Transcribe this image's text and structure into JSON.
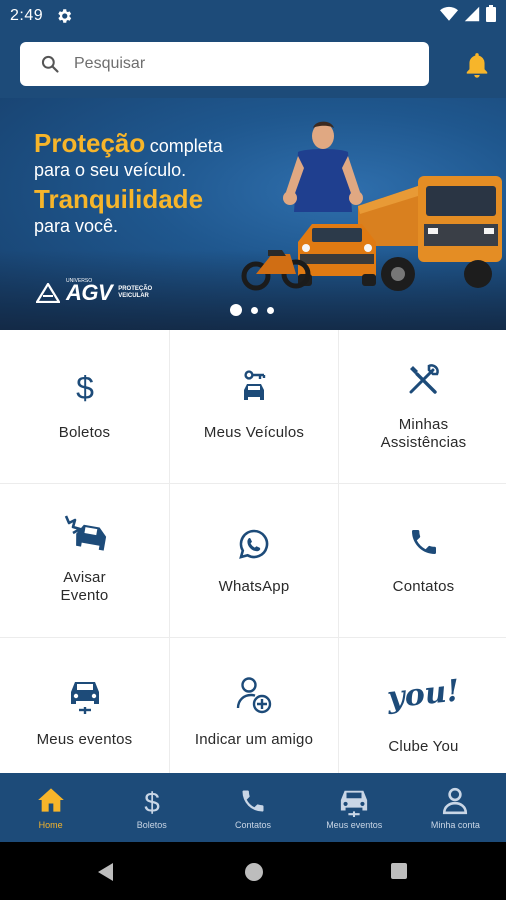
{
  "status_bar": {
    "time": "2:49"
  },
  "header": {
    "search_placeholder": "Pesquisar"
  },
  "banner": {
    "line1_highlight": "Proteção",
    "line1_rest": "completa",
    "line2": "para o seu veículo.",
    "line3_highlight": "Tranquilidade",
    "line4": "para você.",
    "brand": "AGV",
    "brand_top": "UNIVERSO",
    "brand_sub": "PROTEÇÃO VEICULAR",
    "slide_count": 3,
    "active_slide": 1
  },
  "grid": {
    "boletos": "Boletos",
    "meus_veiculos": "Meus Veículos",
    "minhas_assistencias_1": "Minhas",
    "minhas_assistencias_2": "Assistências",
    "avisar_evento_1": "Avisar",
    "avisar_evento_2": "Evento",
    "whatsapp": "WhatsApp",
    "contatos": "Contatos",
    "meus_eventos": "Meus eventos",
    "indicar_amigo": "Indicar um amigo",
    "clube_you": "Clube You",
    "clube_you_logo": "you!"
  },
  "bottom_nav": {
    "home": "Home",
    "boletos": "Boletos",
    "contatos": "Contatos",
    "meus_eventos": "Meus eventos",
    "minha_conta": "Minha conta",
    "active": "home"
  },
  "colors": {
    "primary": "#1d4b79",
    "accent": "#f7b52a",
    "icon": "#1d4b79"
  },
  "icons": {
    "status": [
      "gear-icon",
      "wifi-icon",
      "signal-icon",
      "battery-icon"
    ],
    "header": [
      "search-icon",
      "bell-icon"
    ]
  }
}
